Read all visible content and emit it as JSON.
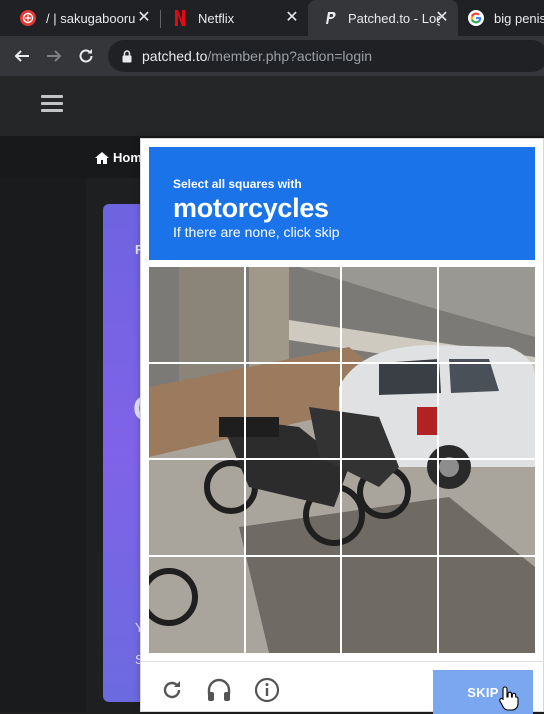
{
  "browser": {
    "tabs": [
      {
        "title": "/ | sakugabooru",
        "icon": "sakugabooru-icon"
      },
      {
        "title": "Netflix",
        "icon": "netflix-icon"
      },
      {
        "title": "Patched.to - Log",
        "icon": "patched-icon"
      },
      {
        "title": "big penis",
        "icon": "google-icon"
      }
    ],
    "url_host": "patched.to",
    "url_path": "/member.php?action=login"
  },
  "site": {
    "home_label": "Home",
    "card_letters": [
      "F",
      "C",
      "Y",
      "S"
    ]
  },
  "captcha": {
    "instruction": "Select all squares with",
    "target": "motorcycles",
    "hint": "If there are none, click skip",
    "skip_label": "SKIP",
    "colors": {
      "prompt_bg": "#1a73e8",
      "skip_bg": "#7aa7ef"
    }
  }
}
